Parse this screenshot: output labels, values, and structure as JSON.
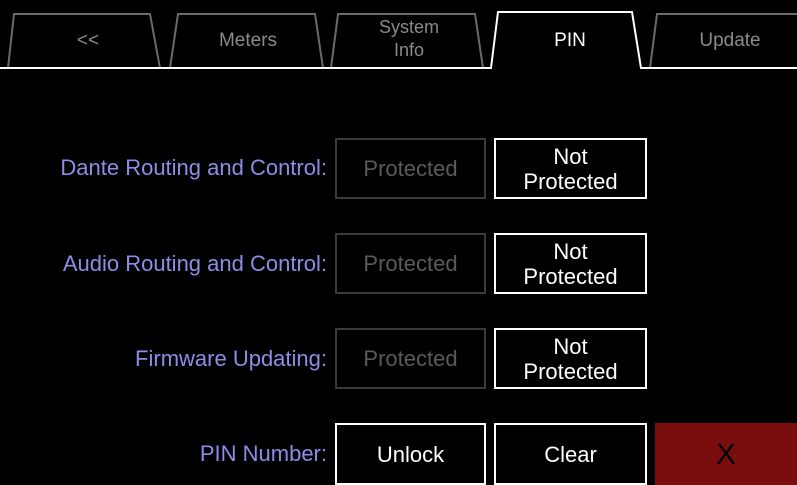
{
  "tabs": [
    {
      "label": "<<",
      "active": false
    },
    {
      "label": "Meters",
      "active": false
    },
    {
      "label": "System\nInfo",
      "active": false
    },
    {
      "label": "PIN",
      "active": true
    },
    {
      "label": "Update",
      "active": false
    }
  ],
  "rows": [
    {
      "label": "Dante Routing and Control:",
      "protected": "Protected",
      "not_protected": "Not\nProtected"
    },
    {
      "label": "Audio Routing and Control:",
      "protected": "Protected",
      "not_protected": "Not\nProtected"
    },
    {
      "label": "Firmware Updating:",
      "protected": "Protected",
      "not_protected": "Not\nProtected"
    }
  ],
  "pin": {
    "label": "PIN Number:",
    "unlock": "Unlock",
    "clear": "Clear",
    "close": "X"
  },
  "colors": {
    "label": "#8b8ee6",
    "inactive_border": "#3a3a3a",
    "active_border": "#ffffff",
    "close_bg": "#7a0e0e"
  }
}
